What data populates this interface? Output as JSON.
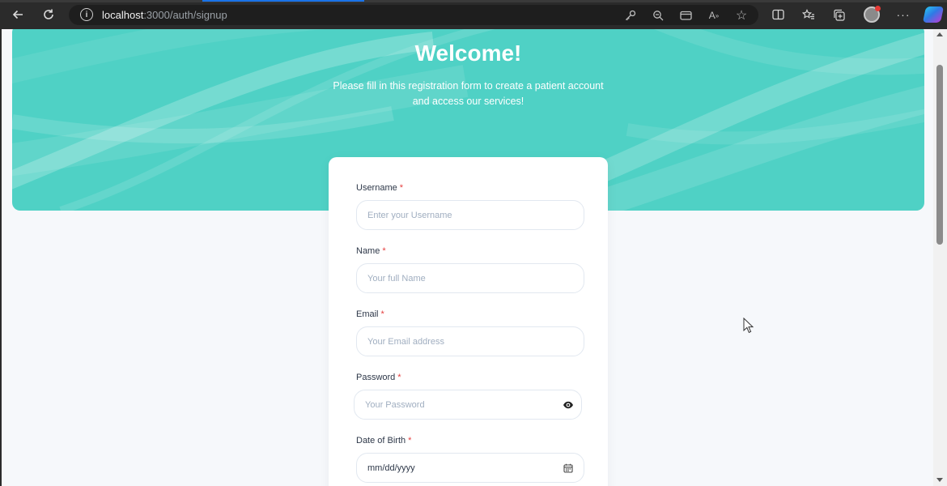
{
  "browser": {
    "url_host": "localhost",
    "url_path": ":3000/auth/signup",
    "icons": {
      "back": "back-arrow-icon",
      "refresh": "refresh-icon",
      "site_info": "info-icon",
      "key": "key-icon",
      "zoom": "zoom-out-icon",
      "wallet": "wallet-icon",
      "read_aloud": "read-aloud-icon",
      "favorite": "star-icon",
      "split_screen": "split-screen-icon",
      "favorites": "favorites-icon",
      "collections": "collections-icon",
      "profile": "profile-avatar",
      "more": "more-icon",
      "copilot": "copilot-icon"
    }
  },
  "hero": {
    "title": "Welcome!",
    "subtitle": "Please fill in this registration form to create a patient account and access our services!",
    "color": "#4fd1c5"
  },
  "form": {
    "required_marker": "*",
    "fields": {
      "username": {
        "label": "Username",
        "placeholder": "Enter your Username"
      },
      "name": {
        "label": "Name",
        "placeholder": "Your full Name"
      },
      "email": {
        "label": "Email",
        "placeholder": "Your Email address"
      },
      "password": {
        "label": "Password",
        "placeholder": "Your Password",
        "toggle_icon": "eye-icon"
      },
      "dob": {
        "label": "Date of Birth",
        "placeholder": "mm/dd/yyyy",
        "picker_icon": "calendar-icon"
      }
    }
  }
}
